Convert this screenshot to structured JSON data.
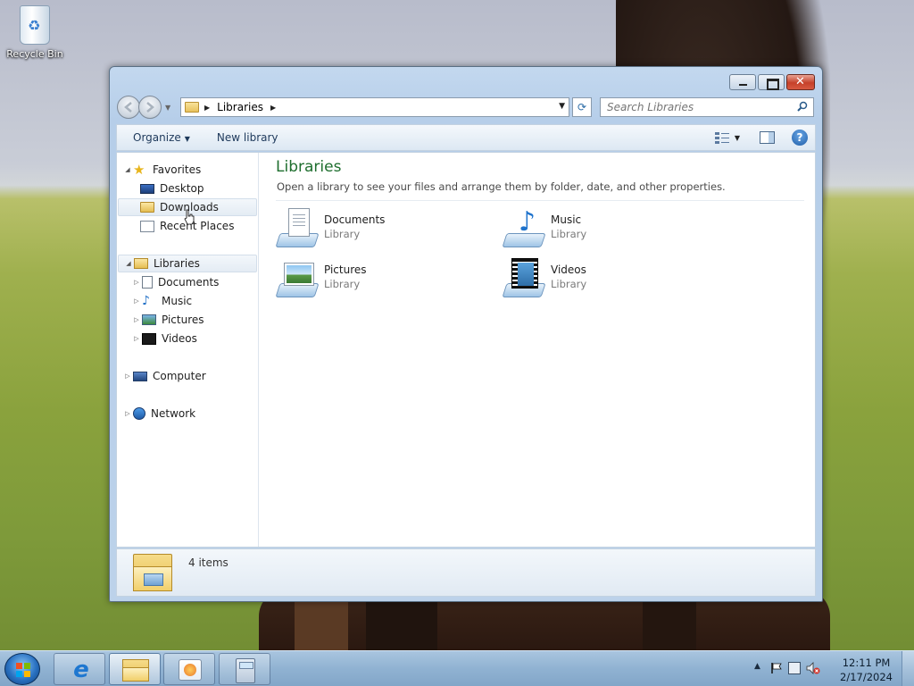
{
  "desktop": {
    "icons": [
      {
        "label": "Recycle Bin",
        "icon": "recycle-bin-icon"
      }
    ]
  },
  "window": {
    "caption_buttons": [
      "minimize",
      "maximize",
      "close"
    ],
    "address": {
      "path": [
        "Libraries"
      ]
    },
    "search": {
      "placeholder": "Search Libraries"
    },
    "toolbar": {
      "organize_label": "Organize",
      "new_library_label": "New library"
    },
    "nav": {
      "favorites": {
        "label": "Favorites",
        "items": [
          {
            "label": "Desktop",
            "icon": "desktop-icon"
          },
          {
            "label": "Downloads",
            "icon": "downloads-folder-icon",
            "hover": true
          },
          {
            "label": "Recent Places",
            "icon": "recent-places-icon"
          }
        ]
      },
      "libraries": {
        "label": "Libraries",
        "selected": true,
        "items": [
          {
            "label": "Documents",
            "icon": "documents-icon"
          },
          {
            "label": "Music",
            "icon": "music-icon"
          },
          {
            "label": "Pictures",
            "icon": "pictures-icon"
          },
          {
            "label": "Videos",
            "icon": "videos-icon"
          }
        ]
      },
      "computer": {
        "label": "Computer"
      },
      "network": {
        "label": "Network"
      }
    },
    "main": {
      "title": "Libraries",
      "subtitle": "Open a library to see your files and arrange them by folder, date, and other properties.",
      "libraries": [
        {
          "name": "Documents",
          "kind": "Library",
          "icon": "documents-library-icon"
        },
        {
          "name": "Music",
          "kind": "Library",
          "icon": "music-library-icon"
        },
        {
          "name": "Pictures",
          "kind": "Library",
          "icon": "pictures-library-icon"
        },
        {
          "name": "Videos",
          "kind": "Library",
          "icon": "videos-library-icon"
        }
      ]
    },
    "details": {
      "items_count": "4 items"
    }
  },
  "taskbar": {
    "pinned": [
      "internet-explorer",
      "windows-explorer",
      "windows-media-player",
      "calculator"
    ],
    "active": "windows-explorer",
    "clock": {
      "time": "12:11 PM",
      "date": "2/17/2024"
    }
  },
  "colors": {
    "title_green": "#1e6e2e",
    "window_frame": "#bcd2ea",
    "taskbar": "#90b2d2"
  }
}
